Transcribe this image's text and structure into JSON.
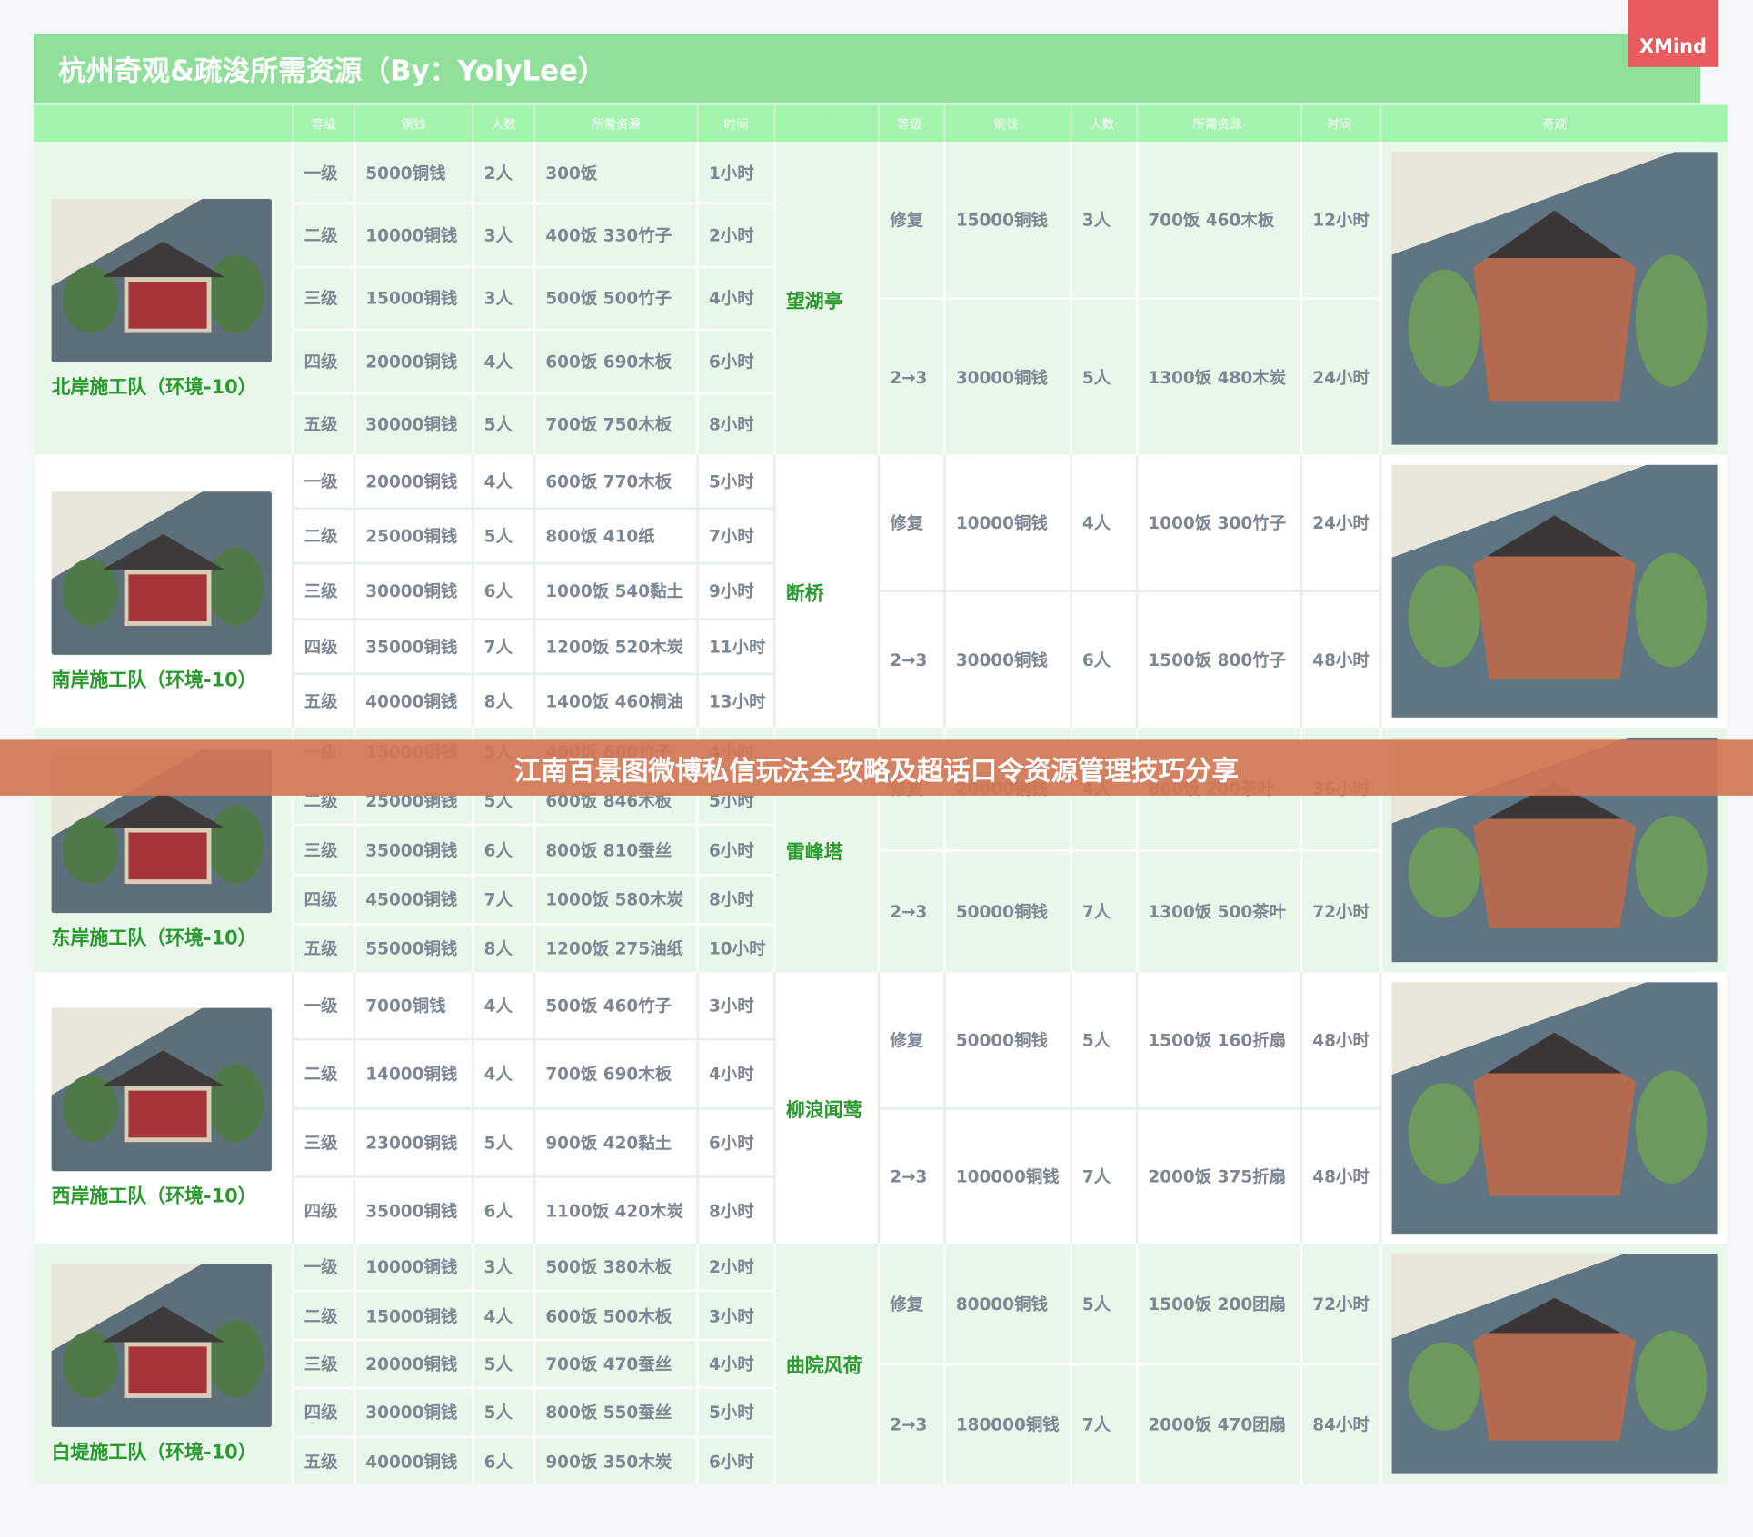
{
  "title": "杭州奇观&疏浚所需资源（By：YolyLee）",
  "badge": "XMind",
  "banner": "江南百景图微博私信玩法全攻略及超话口令资源管理技巧分享",
  "colors": {
    "title_bg": "#90df9a",
    "header_bg": "#a3f5ad",
    "name_green": "#2a9a2e",
    "banner": "#d07654",
    "xmind": "#e85a5e"
  },
  "headers": [
    "",
    "等级",
    "铜钱",
    "人数",
    "所需资源",
    "时间",
    "·",
    "等级·",
    "铜钱·",
    "人数·",
    "所需资源·",
    "时间·",
    "奇观"
  ],
  "sections": [
    {
      "team": "北岸施工队（环境-10）",
      "wonder": "望湖亭",
      "rows": [
        [
          "一级",
          "5000铜钱",
          "2人",
          "300饭",
          "1小时"
        ],
        [
          "二级",
          "10000铜钱",
          "3人",
          "400饭 330竹子",
          "2小时"
        ],
        [
          "三级",
          "15000铜钱",
          "3人",
          "500饭 500竹子",
          "4小时"
        ],
        [
          "四级",
          "20000铜钱",
          "4人",
          "600饭 690木板",
          "6小时"
        ],
        [
          "五级",
          "30000铜钱",
          "5人",
          "700饭 750木板",
          "8小时"
        ]
      ],
      "upgrades": [
        [
          "修复",
          "15000铜钱",
          "3人",
          "700饭 460木板",
          "12小时"
        ],
        [
          "2→3",
          "30000铜钱",
          "5人",
          "1300饭 480木炭",
          "24小时"
        ]
      ]
    },
    {
      "team": "南岸施工队（环境-10）",
      "wonder": "断桥",
      "rows": [
        [
          "一级",
          "20000铜钱",
          "4人",
          "600饭 770木板",
          "5小时"
        ],
        [
          "二级",
          "25000铜钱",
          "5人",
          "800饭 410纸",
          "7小时"
        ],
        [
          "三级",
          "30000铜钱",
          "6人",
          "1000饭 540黏土",
          "9小时"
        ],
        [
          "四级",
          "35000铜钱",
          "7人",
          "1200饭 520木炭",
          "11小时"
        ],
        [
          "五级",
          "40000铜钱",
          "8人",
          "1400饭 460桐油",
          "13小时"
        ]
      ],
      "upgrades": [
        [
          "修复",
          "10000铜钱",
          "4人",
          "1000饭 300竹子",
          "24小时"
        ],
        [
          "2→3",
          "30000铜钱",
          "6人",
          "1500饭 800竹子",
          "48小时"
        ]
      ]
    },
    {
      "team": "东岸施工队（环境-10）",
      "wonder": "雷峰塔",
      "rows": [
        [
          "一级",
          "15000铜钱",
          "5人",
          "400饭 600竹子",
          "4小时"
        ],
        [
          "二级",
          "25000铜钱",
          "5人",
          "600饭 846木板",
          "5小时"
        ],
        [
          "三级",
          "35000铜钱",
          "6人",
          "800饭 810蚕丝",
          "6小时"
        ],
        [
          "四级",
          "45000铜钱",
          "7人",
          "1000饭 580木炭",
          "8小时"
        ],
        [
          "五级",
          "55000铜钱",
          "8人",
          "1200饭 275油纸",
          "10小时"
        ]
      ],
      "upgrades": [
        [
          "修复",
          "20000铜钱",
          "4人",
          "800饭 200茶叶",
          "36小时"
        ],
        [
          "2→3",
          "50000铜钱",
          "7人",
          "1300饭 500茶叶",
          "72小时"
        ]
      ]
    },
    {
      "team": "西岸施工队（环境-10）",
      "wonder": "柳浪闻莺",
      "rows": [
        [
          "一级",
          "7000铜钱",
          "4人",
          "500饭 460竹子",
          "3小时"
        ],
        [
          "二级",
          "14000铜钱",
          "4人",
          "700饭 690木板",
          "4小时"
        ],
        [
          "三级",
          "23000铜钱",
          "5人",
          "900饭 420黏土",
          "6小时"
        ],
        [
          "四级",
          "35000铜钱",
          "6人",
          "1100饭 420木炭",
          "8小时"
        ]
      ],
      "upgrades": [
        [
          "修复",
          "50000铜钱",
          "5人",
          "1500饭 160折扇",
          "48小时"
        ],
        [
          "2→3",
          "100000铜钱",
          "7人",
          "2000饭 375折扇",
          "48小时"
        ]
      ]
    },
    {
      "team": "白堤施工队（环境-10）",
      "wonder": "曲院风荷",
      "rows": [
        [
          "一级",
          "10000铜钱",
          "3人",
          "500饭 380木板",
          "2小时"
        ],
        [
          "二级",
          "15000铜钱",
          "4人",
          "600饭 500木板",
          "3小时"
        ],
        [
          "三级",
          "20000铜钱",
          "5人",
          "700饭 470蚕丝",
          "4小时"
        ],
        [
          "四级",
          "30000铜钱",
          "5人",
          "800饭 550蚕丝",
          "5小时"
        ],
        [
          "五级",
          "40000铜钱",
          "6人",
          "900饭 350木炭",
          "6小时"
        ]
      ],
      "upgrades": [
        [
          "修复",
          "80000铜钱",
          "5人",
          "1500饭 200团扇",
          "72小时"
        ],
        [
          "2→3",
          "180000铜钱",
          "7人",
          "2000饭 470团扇",
          "84小时"
        ]
      ]
    }
  ]
}
